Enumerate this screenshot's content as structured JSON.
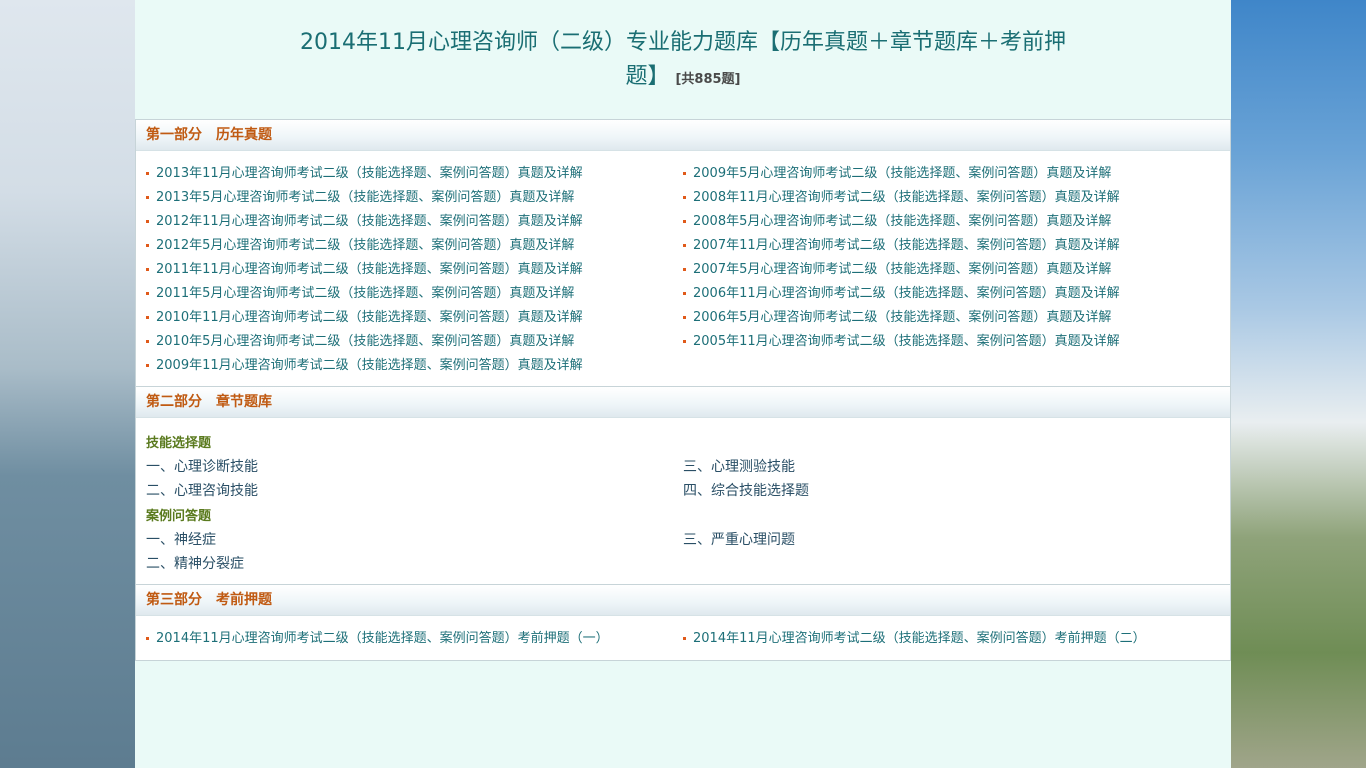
{
  "title": {
    "line1": "2014年11月心理咨询师（二级）专业能力题库【历年真题＋章节题库＋考前押",
    "line2": "题】",
    "count": "[共885题]"
  },
  "section1": {
    "head_part": "第一部分",
    "head_name": "历年真题",
    "left": [
      "2013年11月心理咨询师考试二级（技能选择题、案例问答题）真题及详解",
      "2013年5月心理咨询师考试二级（技能选择题、案例问答题）真题及详解",
      "2012年11月心理咨询师考试二级（技能选择题、案例问答题）真题及详解",
      "2012年5月心理咨询师考试二级（技能选择题、案例问答题）真题及详解",
      "2011年11月心理咨询师考试二级（技能选择题、案例问答题）真题及详解",
      "2011年5月心理咨询师考试二级（技能选择题、案例问答题）真题及详解",
      "2010年11月心理咨询师考试二级（技能选择题、案例问答题）真题及详解",
      "2010年5月心理咨询师考试二级（技能选择题、案例问答题）真题及详解",
      "2009年11月心理咨询师考试二级（技能选择题、案例问答题）真题及详解"
    ],
    "right": [
      "2009年5月心理咨询师考试二级（技能选择题、案例问答题）真题及详解",
      "2008年11月心理咨询师考试二级（技能选择题、案例问答题）真题及详解",
      "2008年5月心理咨询师考试二级（技能选择题、案例问答题）真题及详解",
      "2007年11月心理咨询师考试二级（技能选择题、案例问答题）真题及详解",
      "2007年5月心理咨询师考试二级（技能选择题、案例问答题）真题及详解",
      "2006年11月心理咨询师考试二级（技能选择题、案例问答题）真题及详解",
      "2006年5月心理咨询师考试二级（技能选择题、案例问答题）真题及详解",
      "2005年11月心理咨询师考试二级（技能选择题、案例问答题）真题及详解"
    ]
  },
  "section2": {
    "head_part": "第二部分",
    "head_name": "章节题库",
    "group1_title": "技能选择题",
    "group1": [
      "一、心理诊断技能",
      "三、心理测验技能",
      "二、心理咨询技能",
      "四、综合技能选择题"
    ],
    "group2_title": "案例问答题",
    "group2": [
      "一、神经症",
      "三、严重心理问题",
      "二、精神分裂症"
    ]
  },
  "section3": {
    "head_part": "第三部分",
    "head_name": "考前押题",
    "links": [
      "2014年11月心理咨询师考试二级（技能选择题、案例问答题）考前押题（一）",
      "2014年11月心理咨询师考试二级（技能选择题、案例问答题）考前押题（二）"
    ]
  },
  "colors": {
    "page_bg": "#eafaf7",
    "title": "#1a6e73",
    "section_head": "#c05a12",
    "link": "#1d6f78",
    "bullet": "#e05a1a"
  }
}
